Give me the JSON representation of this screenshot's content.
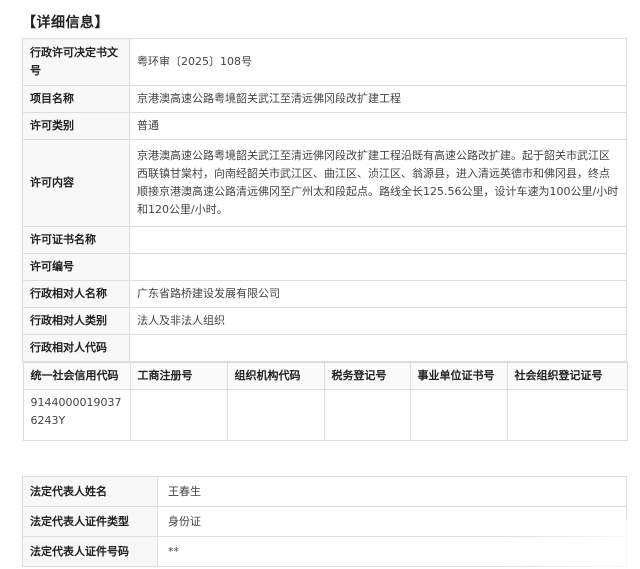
{
  "section_title": "【详细信息】",
  "rows": [
    {
      "label": "行政许可决定书文号",
      "value": "粤环审〔2025〕108号"
    },
    {
      "label": "项目名称",
      "value": "京港澳高速公路粤境韶关武江至清远佛冈段改扩建工程"
    },
    {
      "label": "许可类别",
      "value": "普通"
    },
    {
      "label": "许可内容",
      "value": "京港澳高速公路粤境韶关武江至清远佛冈段改扩建工程沿既有高速公路改扩建。起于韶关市武江区西联镇甘棠村，向南经韶关市武江区、曲江区、浈江区、翁源县，进入清远英德市和佛冈县，终点顺接京港澳高速公路清远佛冈至广州太和段起点。路线全长125.56公里，设计车速为100公里/小时和120公里/小时。"
    },
    {
      "label": "许可证书名称",
      "value": ""
    },
    {
      "label": "许可编号",
      "value": ""
    },
    {
      "label": "行政相对人名称",
      "value": "广东省路桥建设发展有限公司"
    },
    {
      "label": "行政相对人类别",
      "value": "法人及非法人组织"
    },
    {
      "label": "行政相对人代码",
      "value": ""
    }
  ],
  "credit_headers": [
    "统一社会信用代码",
    "工商注册号",
    "组织机构代码",
    "税务登记号",
    "事业单位证书号",
    "社会组织登记证号"
  ],
  "credit_values": [
    "91440000190376243Y",
    "",
    "",
    "",
    "",
    ""
  ],
  "representative": [
    {
      "label": "法定代表人姓名",
      "value": "王春生"
    },
    {
      "label": "法定代表人证件类型",
      "value": "身份证"
    },
    {
      "label": "法定代表人证件号码",
      "value": "**"
    }
  ]
}
